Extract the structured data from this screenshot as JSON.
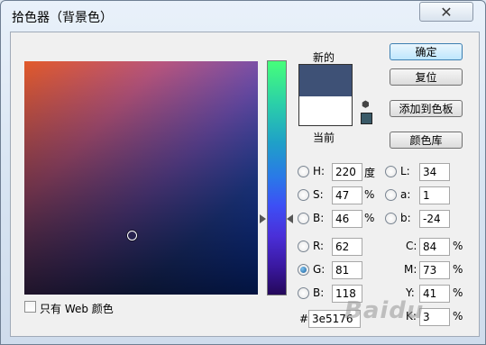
{
  "window": {
    "title": "拾色器（背景色）",
    "close_label": "✕"
  },
  "swatches": {
    "new_label": "新的",
    "current_label": "当前",
    "new_color": "#3e5176",
    "current_color": "#ffffff"
  },
  "buttons": {
    "ok": "确定",
    "reset": "复位",
    "add_to_swatches": "添加到色板",
    "color_libraries": "颜色库"
  },
  "hsb": {
    "h_label": "H:",
    "h_value": "220",
    "h_unit": "度",
    "s_label": "S:",
    "s_value": "47",
    "s_unit": "%",
    "b_label": "B:",
    "b_value": "46",
    "b_unit": "%"
  },
  "lab": {
    "l_label": "L:",
    "l_value": "34",
    "a_label": "a:",
    "a_value": "1",
    "b_label": "b:",
    "b_value": "-24"
  },
  "rgb": {
    "r_label": "R:",
    "r_value": "62",
    "g_label": "G:",
    "g_value": "81",
    "b_label": "B:",
    "b_value": "118"
  },
  "cmyk": {
    "c_label": "C:",
    "c_value": "84",
    "c_unit": "%",
    "m_label": "M:",
    "m_value": "73",
    "m_unit": "%",
    "y_label": "Y:",
    "y_value": "41",
    "y_unit": "%",
    "k_label": "K:",
    "k_value": "3",
    "k_unit": "%"
  },
  "hex": {
    "label": "#",
    "value": "3e5176"
  },
  "web_only": {
    "label": "只有 Web 颜色"
  },
  "watermark": "Baidu"
}
